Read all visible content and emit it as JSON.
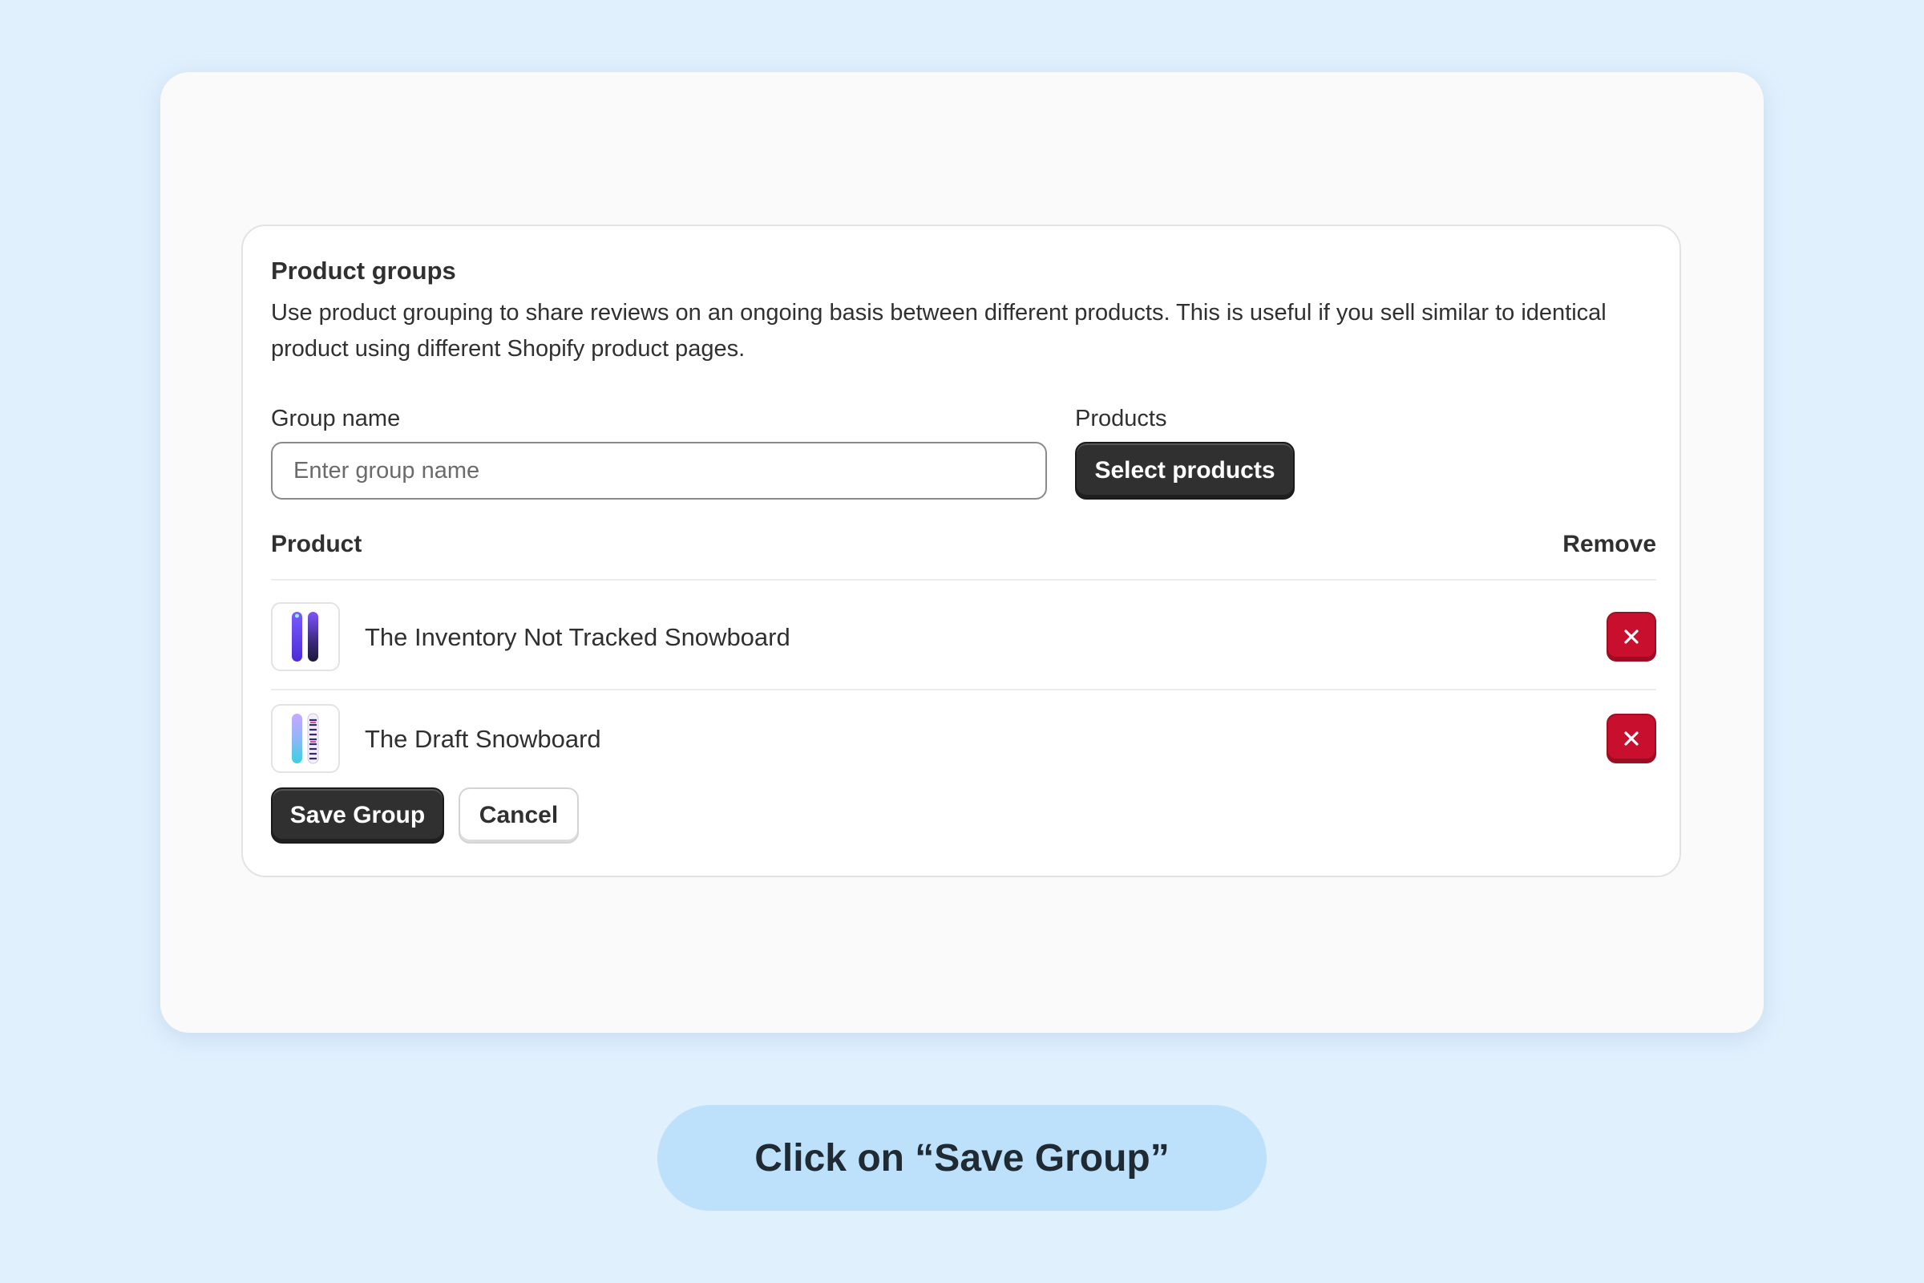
{
  "card": {
    "title": "Product groups",
    "description": "Use product grouping to share reviews on an ongoing basis between different products. This is useful if you sell similar to identical product using different Shopify product pages."
  },
  "form": {
    "group_name_label": "Group name",
    "group_name_placeholder": "Enter group name",
    "group_name_value": "",
    "products_label": "Products",
    "select_products_label": "Select products"
  },
  "table": {
    "columns": [
      "Product",
      "Remove"
    ],
    "rows": [
      {
        "name": "The Inventory Not Tracked Snowboard",
        "thumbnail": "snowboard-purple-icon"
      },
      {
        "name": "The Draft Snowboard",
        "thumbnail": "snowboard-gradient-icon"
      }
    ],
    "remove_icon": "close-icon"
  },
  "actions": {
    "save_label": "Save Group",
    "cancel_label": "Cancel"
  },
  "hint": {
    "text": "Click on “Save Group”"
  },
  "colors": {
    "background": "#e1f0fd",
    "primary_button": "#303030",
    "remove_button": "#c8102e",
    "hint_pill": "#bde0fb"
  }
}
